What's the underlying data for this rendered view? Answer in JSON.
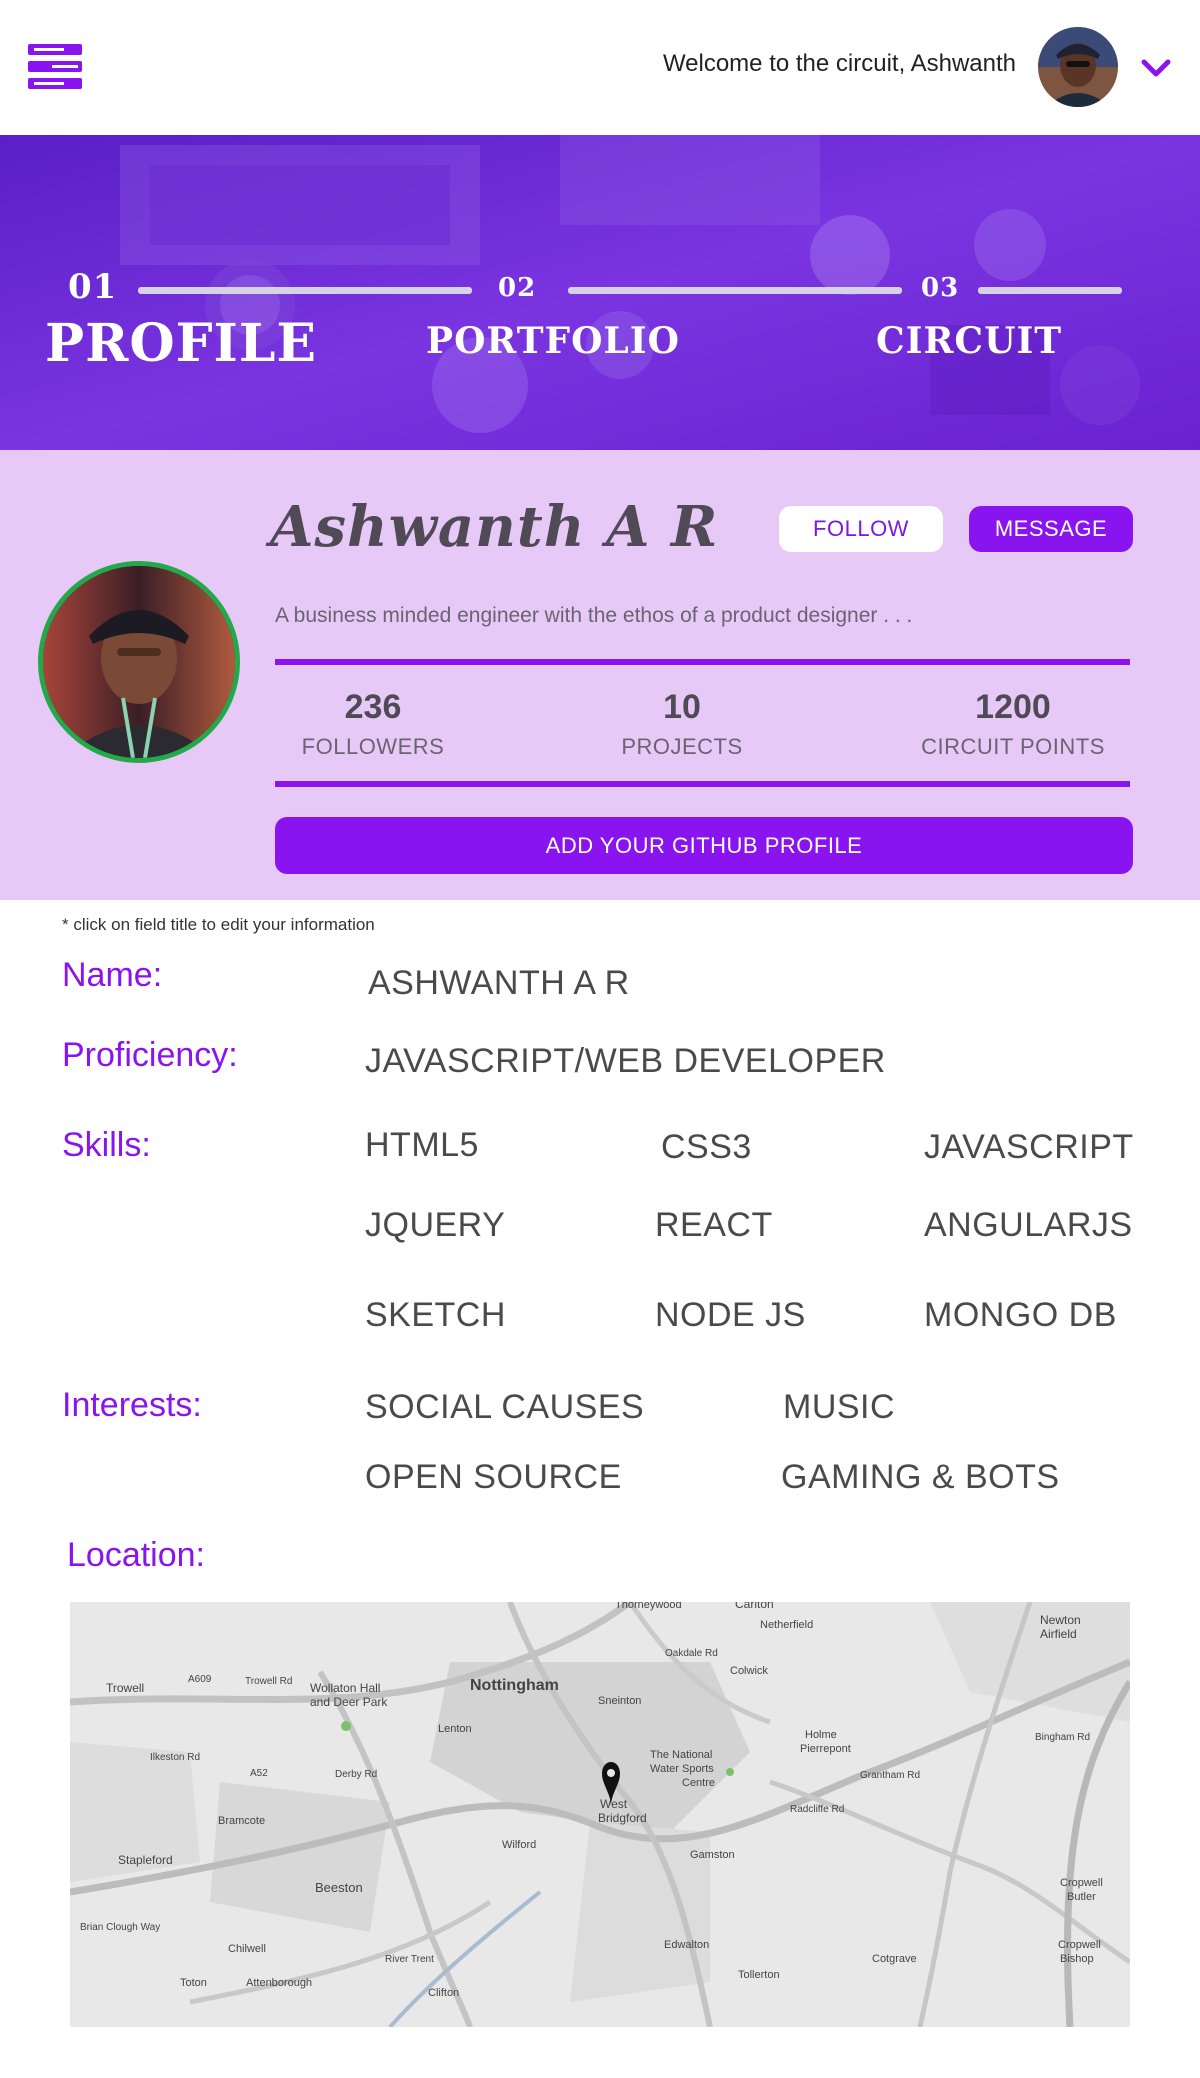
{
  "header": {
    "welcome_text": "Welcome to the circuit, Ashwanth",
    "menu_icon": "hamburger-menu-icon",
    "dropdown_icon": "chevron-down-icon",
    "accent_color": "#8a14f0"
  },
  "steps": [
    {
      "number": "01",
      "label": "PROFILE",
      "active": true
    },
    {
      "number": "02",
      "label": "PORTFOLIO",
      "active": false
    },
    {
      "number": "03",
      "label": "CIRCUIT",
      "active": false
    }
  ],
  "profile": {
    "name": "Ashwanth A R",
    "follow_label": "FOLLOW",
    "message_label": "MESSAGE",
    "bio": "A business minded engineer with the ethos of a product designer . . .",
    "stats": [
      {
        "value": "236",
        "label": "FOLLOWERS"
      },
      {
        "value": "10",
        "label": "PROJECTS"
      },
      {
        "value": "1200",
        "label": "CIRCUIT POINTS"
      }
    ],
    "github_button": "ADD YOUR GITHUB PROFILE"
  },
  "details": {
    "hint": "* click on field title to edit your information",
    "name_label": "Name:",
    "name_value": "ASHWANTH A R",
    "proficiency_label": "Proficiency:",
    "proficiency_value": "JAVASCRIPT/WEB DEVELOPER",
    "skills_label": "Skills:",
    "skills": [
      "HTML5",
      "CSS3",
      "JAVASCRIPT",
      "JQUERY",
      "REACT",
      "ANGULARJS",
      "SKETCH",
      "NODE JS",
      "MONGO DB"
    ],
    "interests_label": "Interests:",
    "interests": [
      "SOCIAL CAUSES",
      "MUSIC",
      "OPEN SOURCE",
      "GAMING & BOTS"
    ],
    "location_label": "Location:"
  },
  "map": {
    "places": [
      "Thorneywood",
      "Carlton",
      "Netherfield",
      "Newton Airfield",
      "Oakdale Rd",
      "Colwick",
      "Trowell",
      "A609",
      "Trowell Rd",
      "Wollaton Hall and Deer Park",
      "Nottingham",
      "Sneinton",
      "Lenton",
      "Holme Pierrepont",
      "Ilkeston Rd",
      "A52",
      "Derby Rd",
      "The National Water Sports Centre",
      "Bramcote",
      "West Bridgford",
      "Grantham Rd",
      "Radcliffe Rd",
      "Stapleford",
      "Wilford",
      "Gamston",
      "Beeston",
      "Cropwell Butler",
      "Brian Clough Way",
      "Chilwell",
      "River Trent",
      "Edwalton",
      "Cotgrave",
      "Cropwell Bishop",
      "Toton",
      "Attenborough",
      "Clifton",
      "Tollerton",
      "Bingham Rd"
    ],
    "pin_icon": "map-pin-icon"
  }
}
